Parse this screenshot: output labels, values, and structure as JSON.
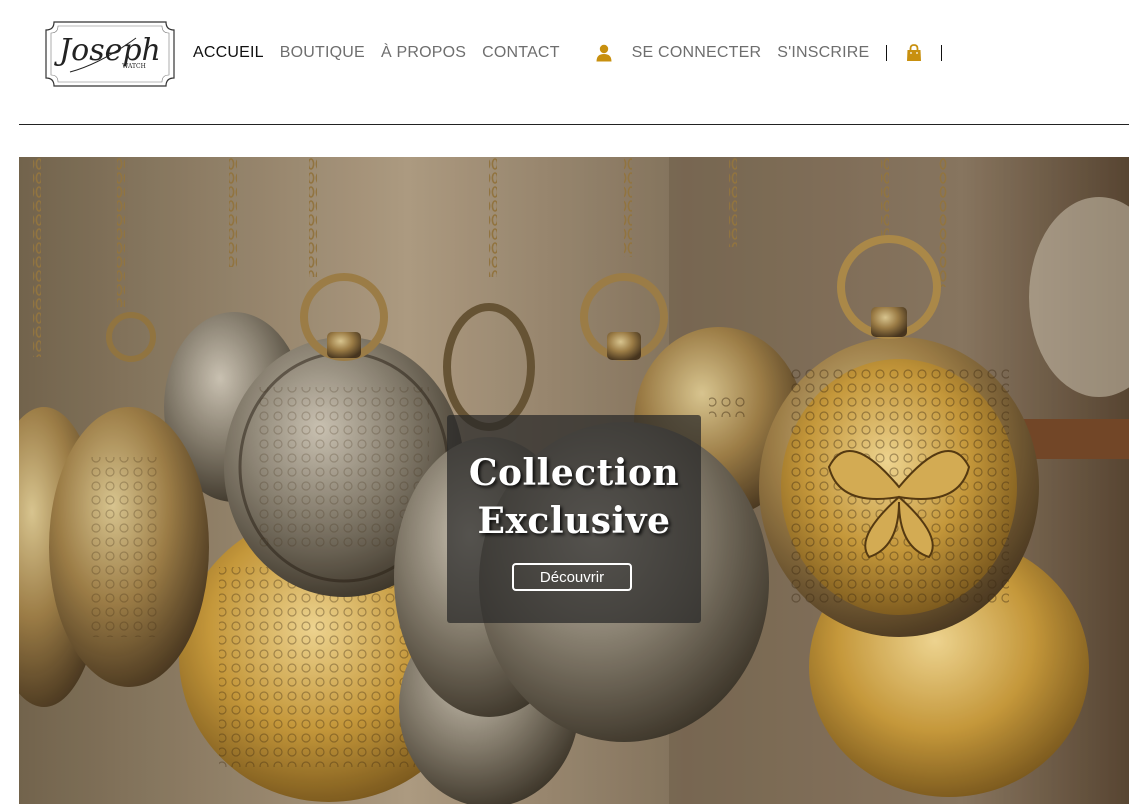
{
  "brand": {
    "logo_script": "Joseph",
    "logo_sub": "WATCH"
  },
  "nav": {
    "items": [
      {
        "label": "ACCUEIL",
        "active": true
      },
      {
        "label": "BOUTIQUE",
        "active": false
      },
      {
        "label": "À PROPOS",
        "active": false
      },
      {
        "label": "CONTACT",
        "active": false
      }
    ],
    "account": {
      "icon": "user-icon",
      "login_label": "SE CONNECTER",
      "register_label": "S'INSCRIRE"
    },
    "cart": {
      "icon": "shopping-bag-icon"
    }
  },
  "hero": {
    "title_line1": "Collection",
    "title_line2": "Exclusive",
    "cta_label": "Découvrir"
  },
  "colors": {
    "accent": "#c8900f",
    "nav_text": "#6e6e6e",
    "nav_active": "#111111",
    "caption_bg": "rgba(40,40,40,0.72)"
  }
}
